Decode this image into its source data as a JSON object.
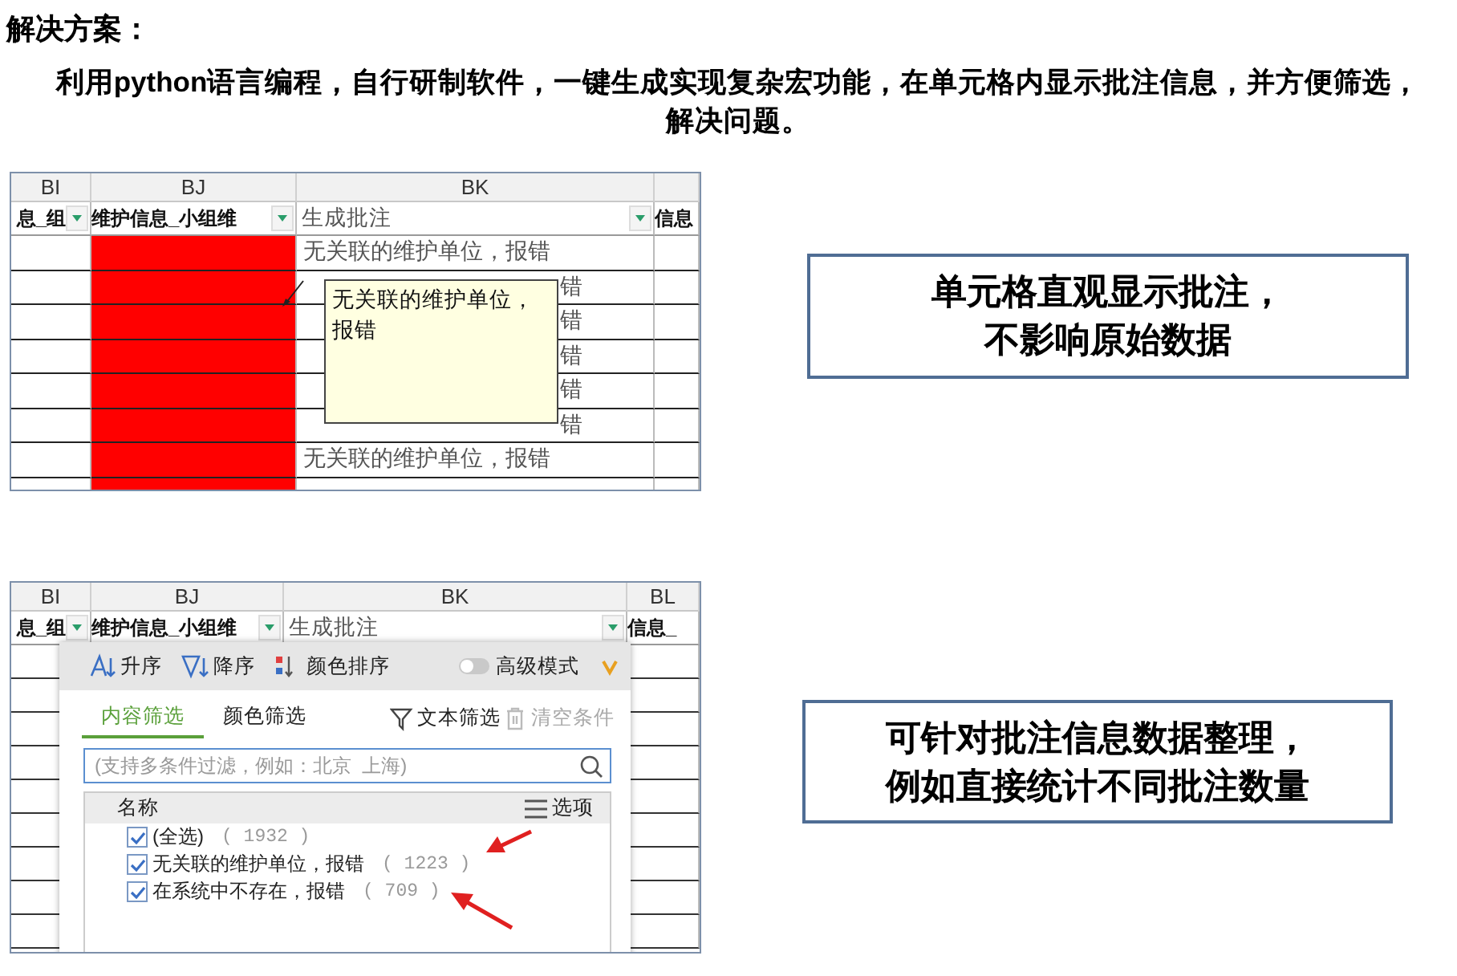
{
  "title": "解决方案：",
  "description": "利用python语言编程，自行研制软件，一键生成实现复杂宏功能，在单元格内显示批注信息，并方便筛选，解决问题。",
  "comment_example": {
    "columns": [
      {
        "letter": "BI",
        "header": "息_组",
        "dropdown": true
      },
      {
        "letter": "BJ",
        "header": "维护信息_小组维",
        "dropdown": true,
        "color": "#ff0000"
      },
      {
        "letter": "BK",
        "header": "生成批注",
        "dropdown": true
      },
      {
        "header": "信息",
        "dropdown": false
      }
    ],
    "rows": [
      {
        "text": "无关联的维护单位，报错"
      },
      {
        "right": "错"
      },
      {
        "right": "错"
      },
      {
        "right": "错"
      },
      {
        "right": "错"
      },
      {
        "right": "错"
      },
      {
        "text": "无关联的维护单位，报错"
      }
    ],
    "comment": "无关联的维护单位，报错",
    "callout": [
      "单元格直观显示批注，",
      "不影响原始数据"
    ]
  },
  "filter_example": {
    "columns": [
      {
        "letter": "BI",
        "header": "息_组",
        "dropdown": true
      },
      {
        "letter": "BJ",
        "header": "维护信息_小组维",
        "dropdown": true
      },
      {
        "letter": "BK",
        "header": "生成批注",
        "dropdown": true
      },
      {
        "letter": "BL",
        "header": "信息_",
        "dropdown": false
      }
    ],
    "sort_buttons": [
      {
        "kind": "ascending",
        "label": "升序"
      },
      {
        "kind": "descending",
        "label": "降序"
      },
      {
        "kind": "color",
        "label": "颜色排序"
      }
    ],
    "advanced_mode": {
      "label": "高级模式",
      "on": false
    },
    "tabs": [
      {
        "label": "内容筛选",
        "selected": true
      },
      {
        "label": "颜色筛选",
        "selected": false
      }
    ],
    "actions": [
      {
        "kind": "text-filter",
        "label": "文本筛选",
        "disabled": false
      },
      {
        "kind": "clear",
        "label": "清空条件",
        "disabled": true
      }
    ],
    "search": {
      "placeholder": "(支持多条件过滤，例如：北京  上海)"
    },
    "list_header": "名称",
    "options_button": "选项",
    "items": [
      {
        "label": "(全选)",
        "count": "( 1932 )",
        "checked": true
      },
      {
        "label": "无关联的维护单位，报错",
        "count": "( 1223 )",
        "checked": true
      },
      {
        "label": "在系统中不存在，报错",
        "count": "( 709 )",
        "checked": true
      }
    ],
    "callout": [
      "可针对批注信息数据整理，",
      "例如直接统计不同批注数量"
    ]
  }
}
